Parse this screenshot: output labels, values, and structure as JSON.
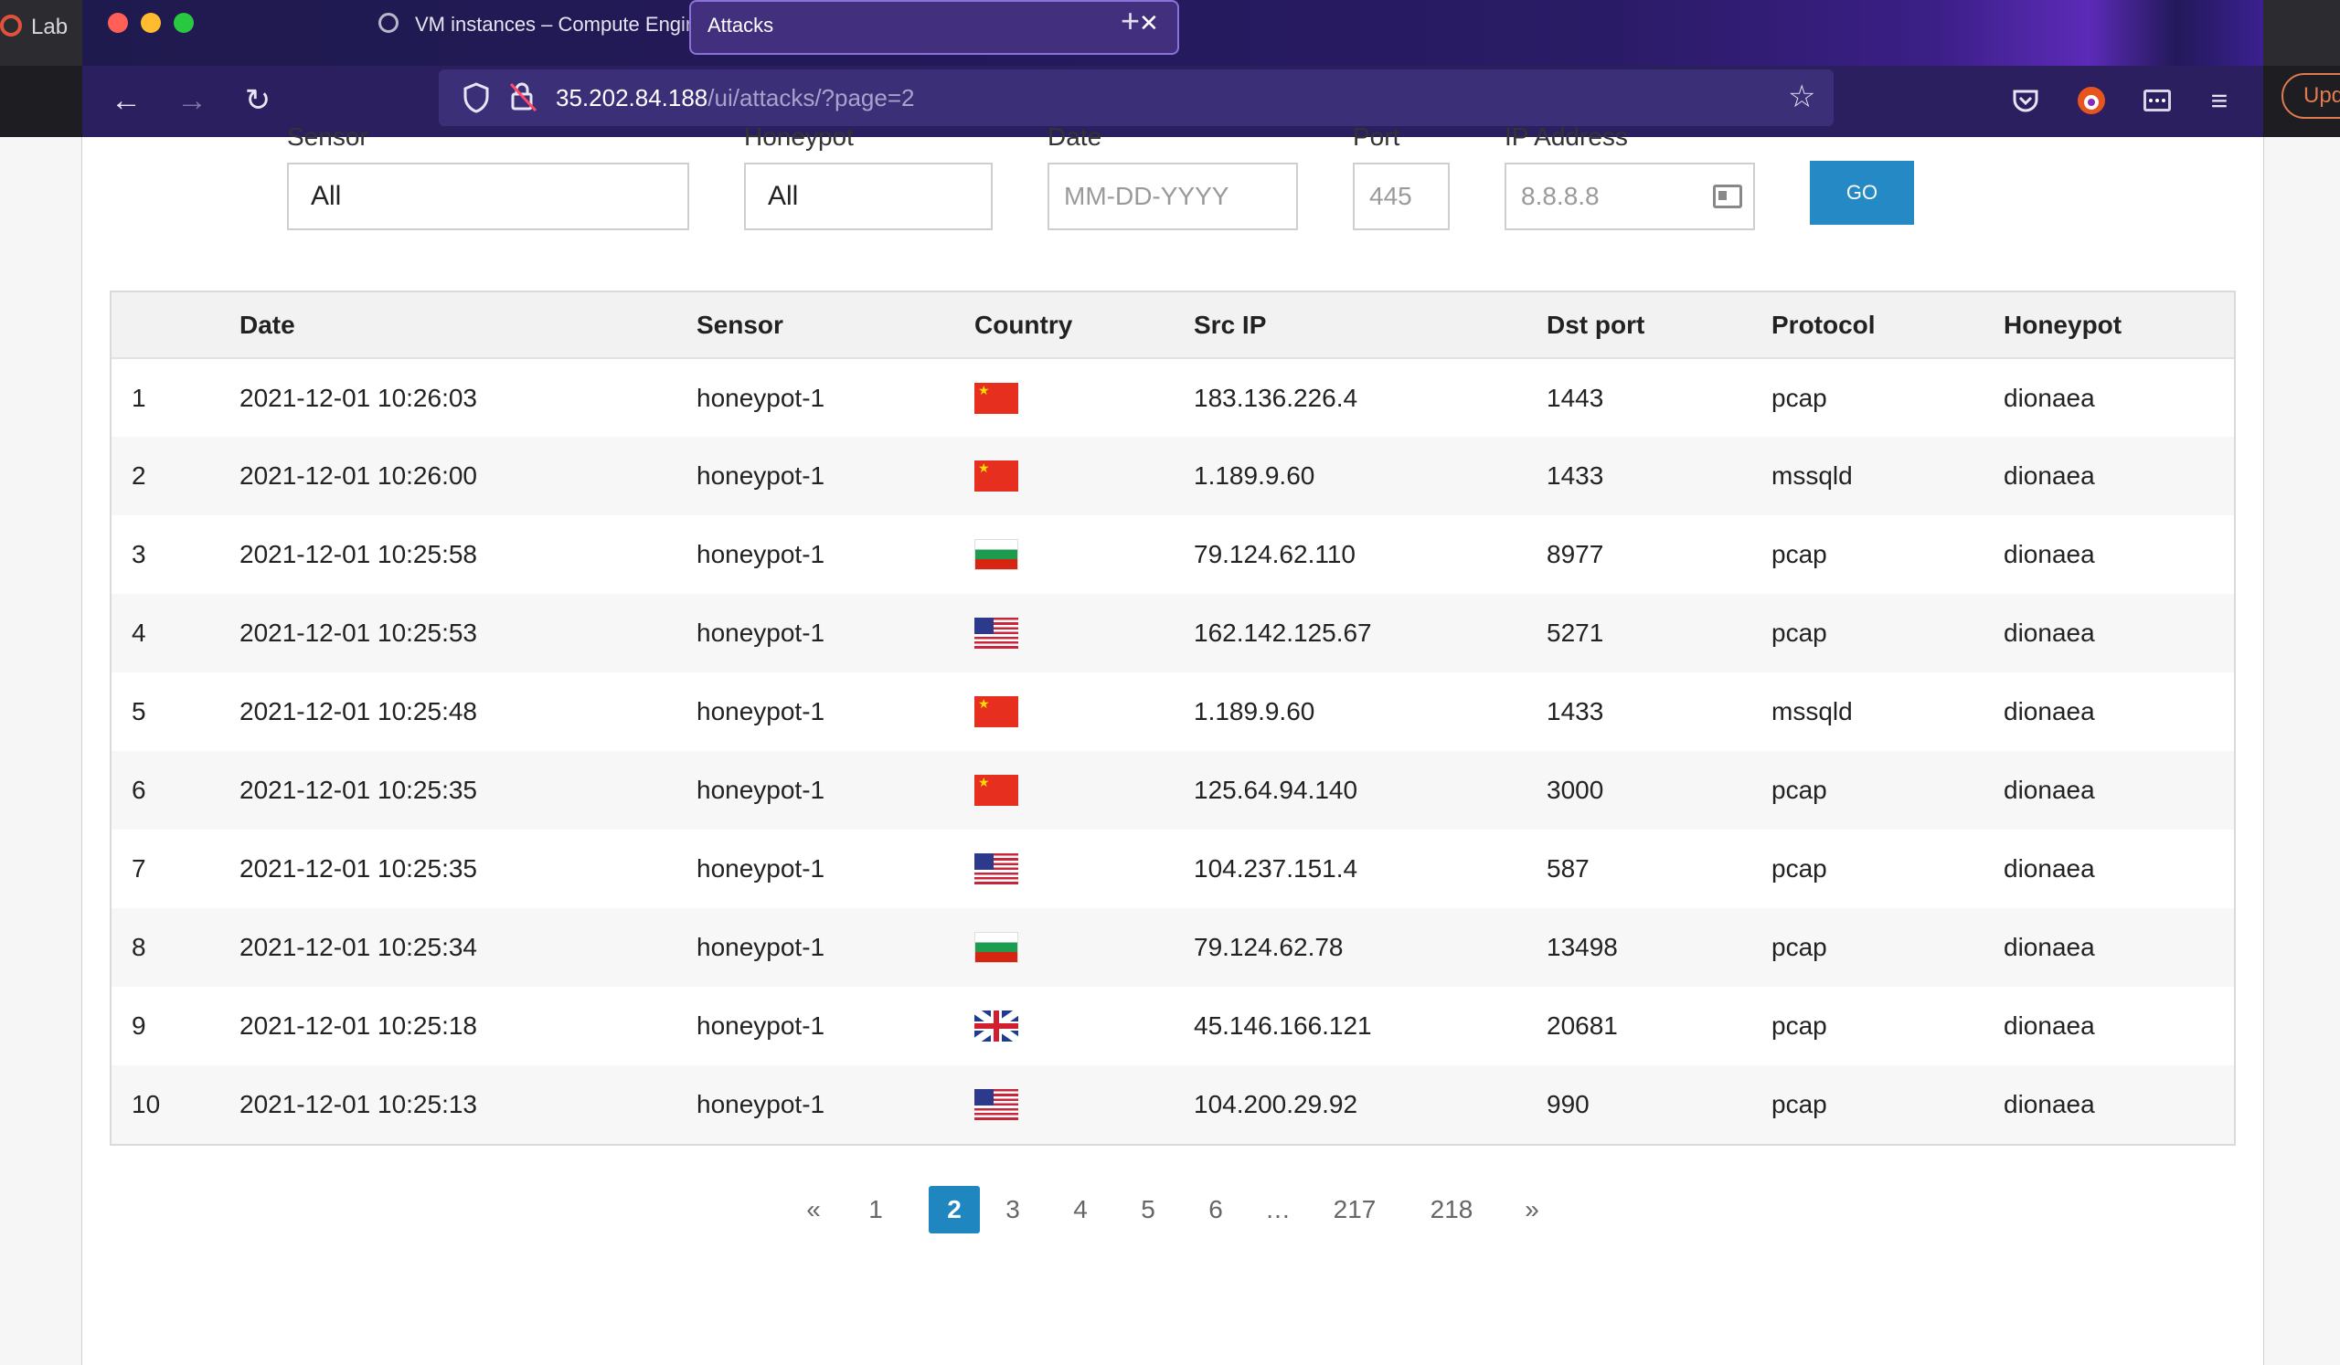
{
  "background_window": {
    "tab_label": "Lab",
    "right_button_label": "Upd"
  },
  "browser": {
    "tabs": [
      {
        "label": "VM instances – Compute Engine",
        "active": false
      },
      {
        "label": "Attacks",
        "active": true
      }
    ],
    "url_host": "35.202.84.188",
    "url_path": "/ui/attacks/?page=2"
  },
  "filters": {
    "sensor": {
      "label": "Sensor",
      "value": "All"
    },
    "honeypot": {
      "label": "Honeypot",
      "value": "All"
    },
    "date": {
      "label": "Date",
      "placeholder": "MM-DD-YYYY"
    },
    "port": {
      "label": "Port",
      "placeholder": "445"
    },
    "ip": {
      "label": "IP Address",
      "placeholder": "8.8.8.8"
    },
    "go_label": "GO"
  },
  "table": {
    "columns": [
      "",
      "Date",
      "Sensor",
      "Country",
      "Src IP",
      "Dst port",
      "Protocol",
      "Honeypot"
    ],
    "rows": [
      {
        "n": "1",
        "date": "2021-12-01 10:26:03",
        "sensor": "honeypot-1",
        "country": "cn",
        "src_ip": "183.136.226.4",
        "dst_port": "1443",
        "protocol": "pcap",
        "honeypot": "dionaea"
      },
      {
        "n": "2",
        "date": "2021-12-01 10:26:00",
        "sensor": "honeypot-1",
        "country": "cn",
        "src_ip": "1.189.9.60",
        "dst_port": "1433",
        "protocol": "mssqld",
        "honeypot": "dionaea"
      },
      {
        "n": "3",
        "date": "2021-12-01 10:25:58",
        "sensor": "honeypot-1",
        "country": "bg",
        "src_ip": "79.124.62.110",
        "dst_port": "8977",
        "protocol": "pcap",
        "honeypot": "dionaea"
      },
      {
        "n": "4",
        "date": "2021-12-01 10:25:53",
        "sensor": "honeypot-1",
        "country": "us",
        "src_ip": "162.142.125.67",
        "dst_port": "5271",
        "protocol": "pcap",
        "honeypot": "dionaea"
      },
      {
        "n": "5",
        "date": "2021-12-01 10:25:48",
        "sensor": "honeypot-1",
        "country": "cn",
        "src_ip": "1.189.9.60",
        "dst_port": "1433",
        "protocol": "mssqld",
        "honeypot": "dionaea"
      },
      {
        "n": "6",
        "date": "2021-12-01 10:25:35",
        "sensor": "honeypot-1",
        "country": "cn",
        "src_ip": "125.64.94.140",
        "dst_port": "3000",
        "protocol": "pcap",
        "honeypot": "dionaea"
      },
      {
        "n": "7",
        "date": "2021-12-01 10:25:35",
        "sensor": "honeypot-1",
        "country": "us",
        "src_ip": "104.237.151.4",
        "dst_port": "587",
        "protocol": "pcap",
        "honeypot": "dionaea"
      },
      {
        "n": "8",
        "date": "2021-12-01 10:25:34",
        "sensor": "honeypot-1",
        "country": "bg",
        "src_ip": "79.124.62.78",
        "dst_port": "13498",
        "protocol": "pcap",
        "honeypot": "dionaea"
      },
      {
        "n": "9",
        "date": "2021-12-01 10:25:18",
        "sensor": "honeypot-1",
        "country": "gb",
        "src_ip": "45.146.166.121",
        "dst_port": "20681",
        "protocol": "pcap",
        "honeypot": "dionaea"
      },
      {
        "n": "10",
        "date": "2021-12-01 10:25:13",
        "sensor": "honeypot-1",
        "country": "us",
        "src_ip": "104.200.29.92",
        "dst_port": "990",
        "protocol": "pcap",
        "honeypot": "dionaea"
      }
    ]
  },
  "pagination": {
    "items": [
      {
        "label": "«",
        "type": "prev"
      },
      {
        "label": "1",
        "type": "page"
      },
      {
        "label": "2",
        "type": "page",
        "active": true
      },
      {
        "label": "3",
        "type": "page"
      },
      {
        "label": "4",
        "type": "page"
      },
      {
        "label": "5",
        "type": "page"
      },
      {
        "label": "6",
        "type": "page"
      },
      {
        "label": "…",
        "type": "ellipsis"
      },
      {
        "label": "217",
        "type": "page"
      },
      {
        "label": "218",
        "type": "page"
      },
      {
        "label": "»",
        "type": "next"
      }
    ]
  },
  "colors": {
    "accent": "#1f86c0",
    "titlebar": "#23195a",
    "navbar": "#2b1f5f"
  }
}
